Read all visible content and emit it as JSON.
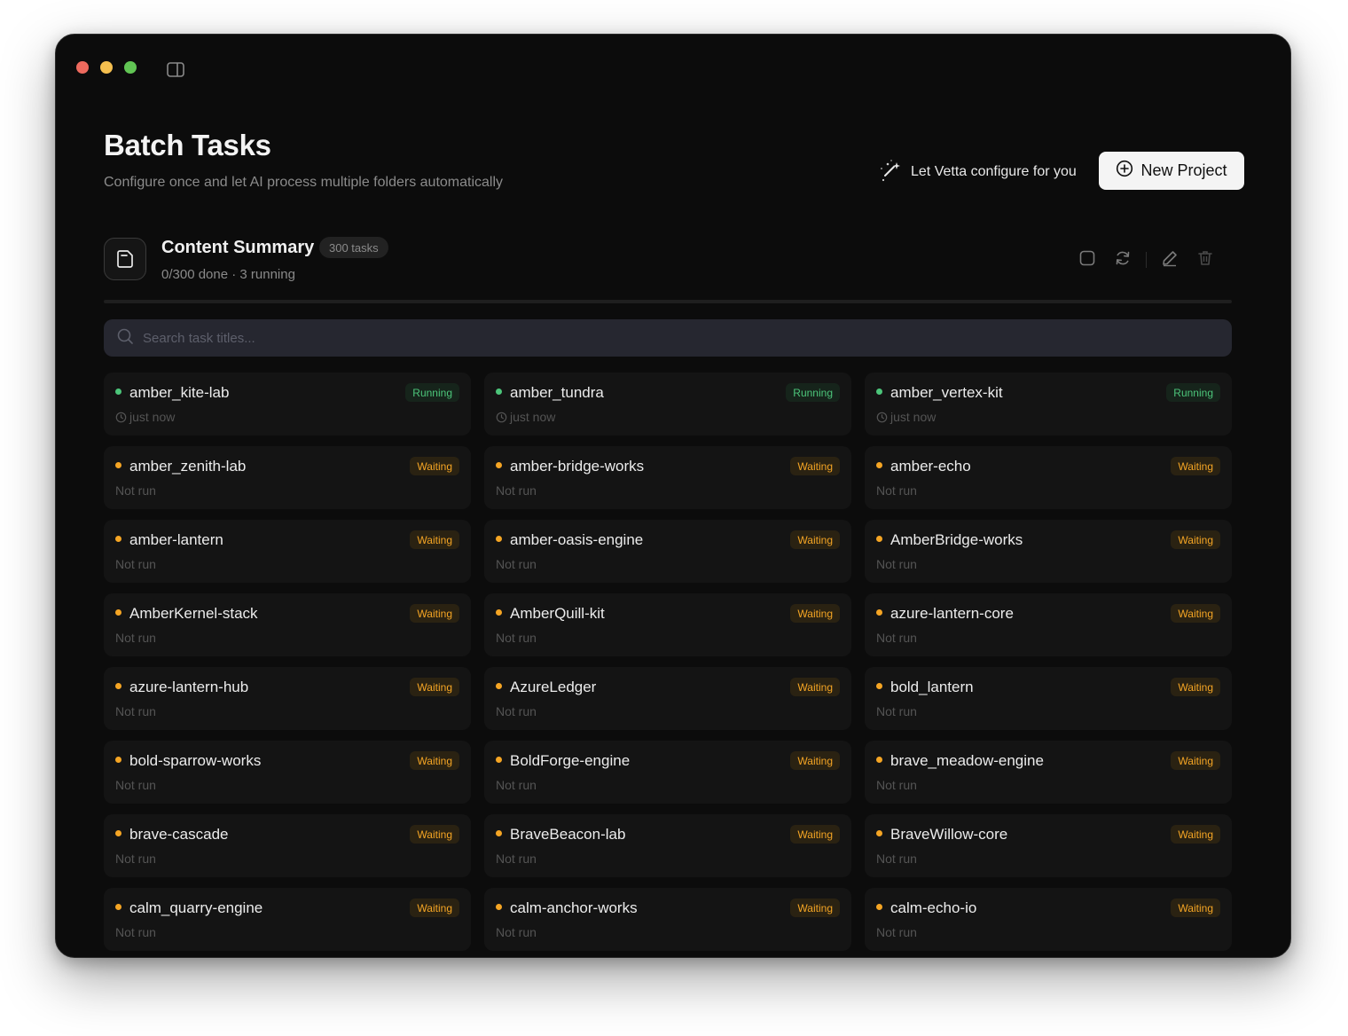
{
  "header": {
    "title": "Batch Tasks",
    "subtitle": "Configure once and let AI process multiple folders automatically"
  },
  "actions": {
    "configure_label": "Let Vetta configure for you",
    "new_project_label": "New Project"
  },
  "project": {
    "name": "Content Summary",
    "task_count_label": "300 tasks",
    "meta": "0/300 done · 3 running",
    "progress_fraction": 0.0
  },
  "search": {
    "placeholder": "Search task titles..."
  },
  "tasks": [
    {
      "name": "amber_kite-lab",
      "status": "running",
      "badge": "Running",
      "sub": "just now"
    },
    {
      "name": "amber_tundra",
      "status": "running",
      "badge": "Running",
      "sub": "just now"
    },
    {
      "name": "amber_vertex-kit",
      "status": "running",
      "badge": "Running",
      "sub": "just now"
    },
    {
      "name": "amber_zenith-lab",
      "status": "waiting",
      "badge": "Waiting",
      "sub": "Not run"
    },
    {
      "name": "amber-bridge-works",
      "status": "waiting",
      "badge": "Waiting",
      "sub": "Not run"
    },
    {
      "name": "amber-echo",
      "status": "waiting",
      "badge": "Waiting",
      "sub": "Not run"
    },
    {
      "name": "amber-lantern",
      "status": "waiting",
      "badge": "Waiting",
      "sub": "Not run"
    },
    {
      "name": "amber-oasis-engine",
      "status": "waiting",
      "badge": "Waiting",
      "sub": "Not run"
    },
    {
      "name": "AmberBridge-works",
      "status": "waiting",
      "badge": "Waiting",
      "sub": "Not run"
    },
    {
      "name": "AmberKernel-stack",
      "status": "waiting",
      "badge": "Waiting",
      "sub": "Not run"
    },
    {
      "name": "AmberQuill-kit",
      "status": "waiting",
      "badge": "Waiting",
      "sub": "Not run"
    },
    {
      "name": "azure-lantern-core",
      "status": "waiting",
      "badge": "Waiting",
      "sub": "Not run"
    },
    {
      "name": "azure-lantern-hub",
      "status": "waiting",
      "badge": "Waiting",
      "sub": "Not run"
    },
    {
      "name": "AzureLedger",
      "status": "waiting",
      "badge": "Waiting",
      "sub": "Not run"
    },
    {
      "name": "bold_lantern",
      "status": "waiting",
      "badge": "Waiting",
      "sub": "Not run"
    },
    {
      "name": "bold-sparrow-works",
      "status": "waiting",
      "badge": "Waiting",
      "sub": "Not run"
    },
    {
      "name": "BoldForge-engine",
      "status": "waiting",
      "badge": "Waiting",
      "sub": "Not run"
    },
    {
      "name": "brave_meadow-engine",
      "status": "waiting",
      "badge": "Waiting",
      "sub": "Not run"
    },
    {
      "name": "brave-cascade",
      "status": "waiting",
      "badge": "Waiting",
      "sub": "Not run"
    },
    {
      "name": "BraveBeacon-lab",
      "status": "waiting",
      "badge": "Waiting",
      "sub": "Not run"
    },
    {
      "name": "BraveWillow-core",
      "status": "waiting",
      "badge": "Waiting",
      "sub": "Not run"
    },
    {
      "name": "calm_quarry-engine",
      "status": "waiting",
      "badge": "Waiting",
      "sub": "Not run"
    },
    {
      "name": "calm-anchor-works",
      "status": "waiting",
      "badge": "Waiting",
      "sub": "Not run"
    },
    {
      "name": "calm-echo-io",
      "status": "waiting",
      "badge": "Waiting",
      "sub": "Not run"
    }
  ],
  "icons": {
    "window_controls": [
      "close-dot",
      "minimize-dot",
      "zoom-dot"
    ],
    "sidebar_toggle": "sidebar-toggle-icon",
    "project": "folder-document-icon",
    "project_actions": [
      "stop-square-icon",
      "refresh-icon",
      "edit-pencil-icon",
      "trash-icon"
    ]
  },
  "colors": {
    "running": "#4cc57a",
    "waiting": "#f5a524",
    "window_bg": "#0c0c0c",
    "card_bg": "#141414",
    "search_bg": "#262730"
  }
}
